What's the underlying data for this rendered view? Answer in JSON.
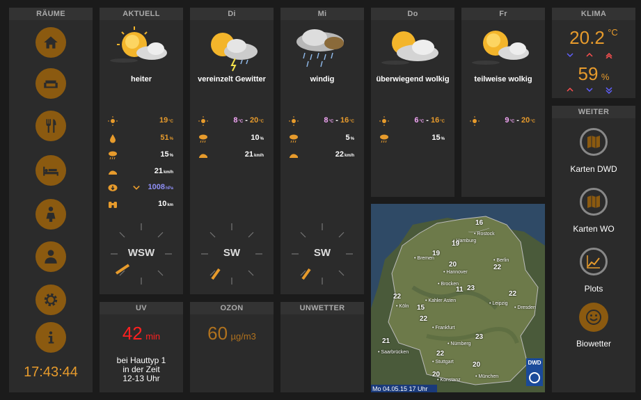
{
  "colors": {
    "accent": "#e79b2c",
    "btn": "#8b5a10",
    "min_temp": "#f2a6f5",
    "pressure": "#8f8ff6",
    "uv_red": "#ff2020"
  },
  "rooms": {
    "title": "RÄUME",
    "buttons": [
      {
        "icon": "home-icon"
      },
      {
        "icon": "sofa-icon"
      },
      {
        "icon": "cutlery-icon"
      },
      {
        "icon": "bed-icon"
      },
      {
        "icon": "person-icon"
      },
      {
        "icon": "user-office-icon"
      },
      {
        "icon": "gear-icon"
      },
      {
        "icon": "info-icon"
      }
    ],
    "clock": "17:43:44"
  },
  "today": {
    "title": "AKTUELL",
    "condition": "heiter",
    "weather_icon": "sun-cloud-icon",
    "temp": "19",
    "temp_unit": "°C",
    "humidity": "51",
    "humidity_unit": "%",
    "rain_prob": "15",
    "rain_unit": "%",
    "wind": "21",
    "wind_unit": "km/h",
    "pressure": "1008",
    "pressure_unit": "hPa",
    "visibility": "10",
    "visibility_unit": "km",
    "wind_dir": "WSW"
  },
  "forecast": [
    {
      "day": "Di",
      "condition": "vereinzelt Gewitter",
      "weather_icon": "thunderstorm-icon",
      "min": "8",
      "max": "20",
      "unit": "°C",
      "rain": "10",
      "rain_unit": "%",
      "wind": "21",
      "wind_unit": "km/h",
      "wind_dir": "SW"
    },
    {
      "day": "Mi",
      "condition": "windig",
      "weather_icon": "rain-cloud-icon",
      "min": "8",
      "max": "16",
      "unit": "°C",
      "rain": "5",
      "rain_unit": "%",
      "wind": "22",
      "wind_unit": "km/h",
      "wind_dir": "SW"
    },
    {
      "day": "Do",
      "condition": "überwiegend wolkig",
      "weather_icon": "mostly-cloudy-icon",
      "min": "6",
      "max": "16",
      "unit": "°C",
      "rain": "15",
      "rain_unit": "%"
    },
    {
      "day": "Fr",
      "condition": "teilweise wolkig",
      "weather_icon": "partly-cloudy-icon",
      "min": "9",
      "max": "20",
      "unit": "°C"
    }
  ],
  "uv": {
    "title": "UV",
    "value": "42",
    "unit": "min",
    "text1": "bei Hauttyp 1",
    "text2": "in der Zeit",
    "text3": "12-13 Uhr"
  },
  "ozone": {
    "title": "OZON",
    "value": "60",
    "unit": "µg/m3"
  },
  "storm": {
    "title": "UNWETTER"
  },
  "map": {
    "caption": "Mo 04.05.15 17 Uhr",
    "logo": "DWD",
    "cities": [
      "Hamburg",
      "Rostock",
      "Bremen",
      "Hannover",
      "Berlin",
      "Brocken",
      "Kahler Asten",
      "Köln",
      "Leipzig",
      "Dresden",
      "Frankfurt",
      "Nürnberg",
      "Saarbrücken",
      "Stuttgart",
      "München",
      "Konstanz"
    ],
    "temps": [
      "16",
      "19",
      "19",
      "20",
      "22",
      "11",
      "23",
      "22",
      "15",
      "22",
      "22",
      "23",
      "21",
      "22",
      "20",
      "20"
    ]
  },
  "climate": {
    "title": "KLIMA",
    "temp": "20.2",
    "temp_unit": "°C",
    "humidity": "59",
    "humidity_unit": "%"
  },
  "more": {
    "title": "WEITER",
    "items": [
      {
        "label": "Karten DWD",
        "icon": "map-icon"
      },
      {
        "label": "Karten WO",
        "icon": "map-icon"
      },
      {
        "label": "Plots",
        "icon": "chart-icon"
      },
      {
        "label": "Biowetter",
        "icon": "smiley-icon"
      }
    ]
  }
}
